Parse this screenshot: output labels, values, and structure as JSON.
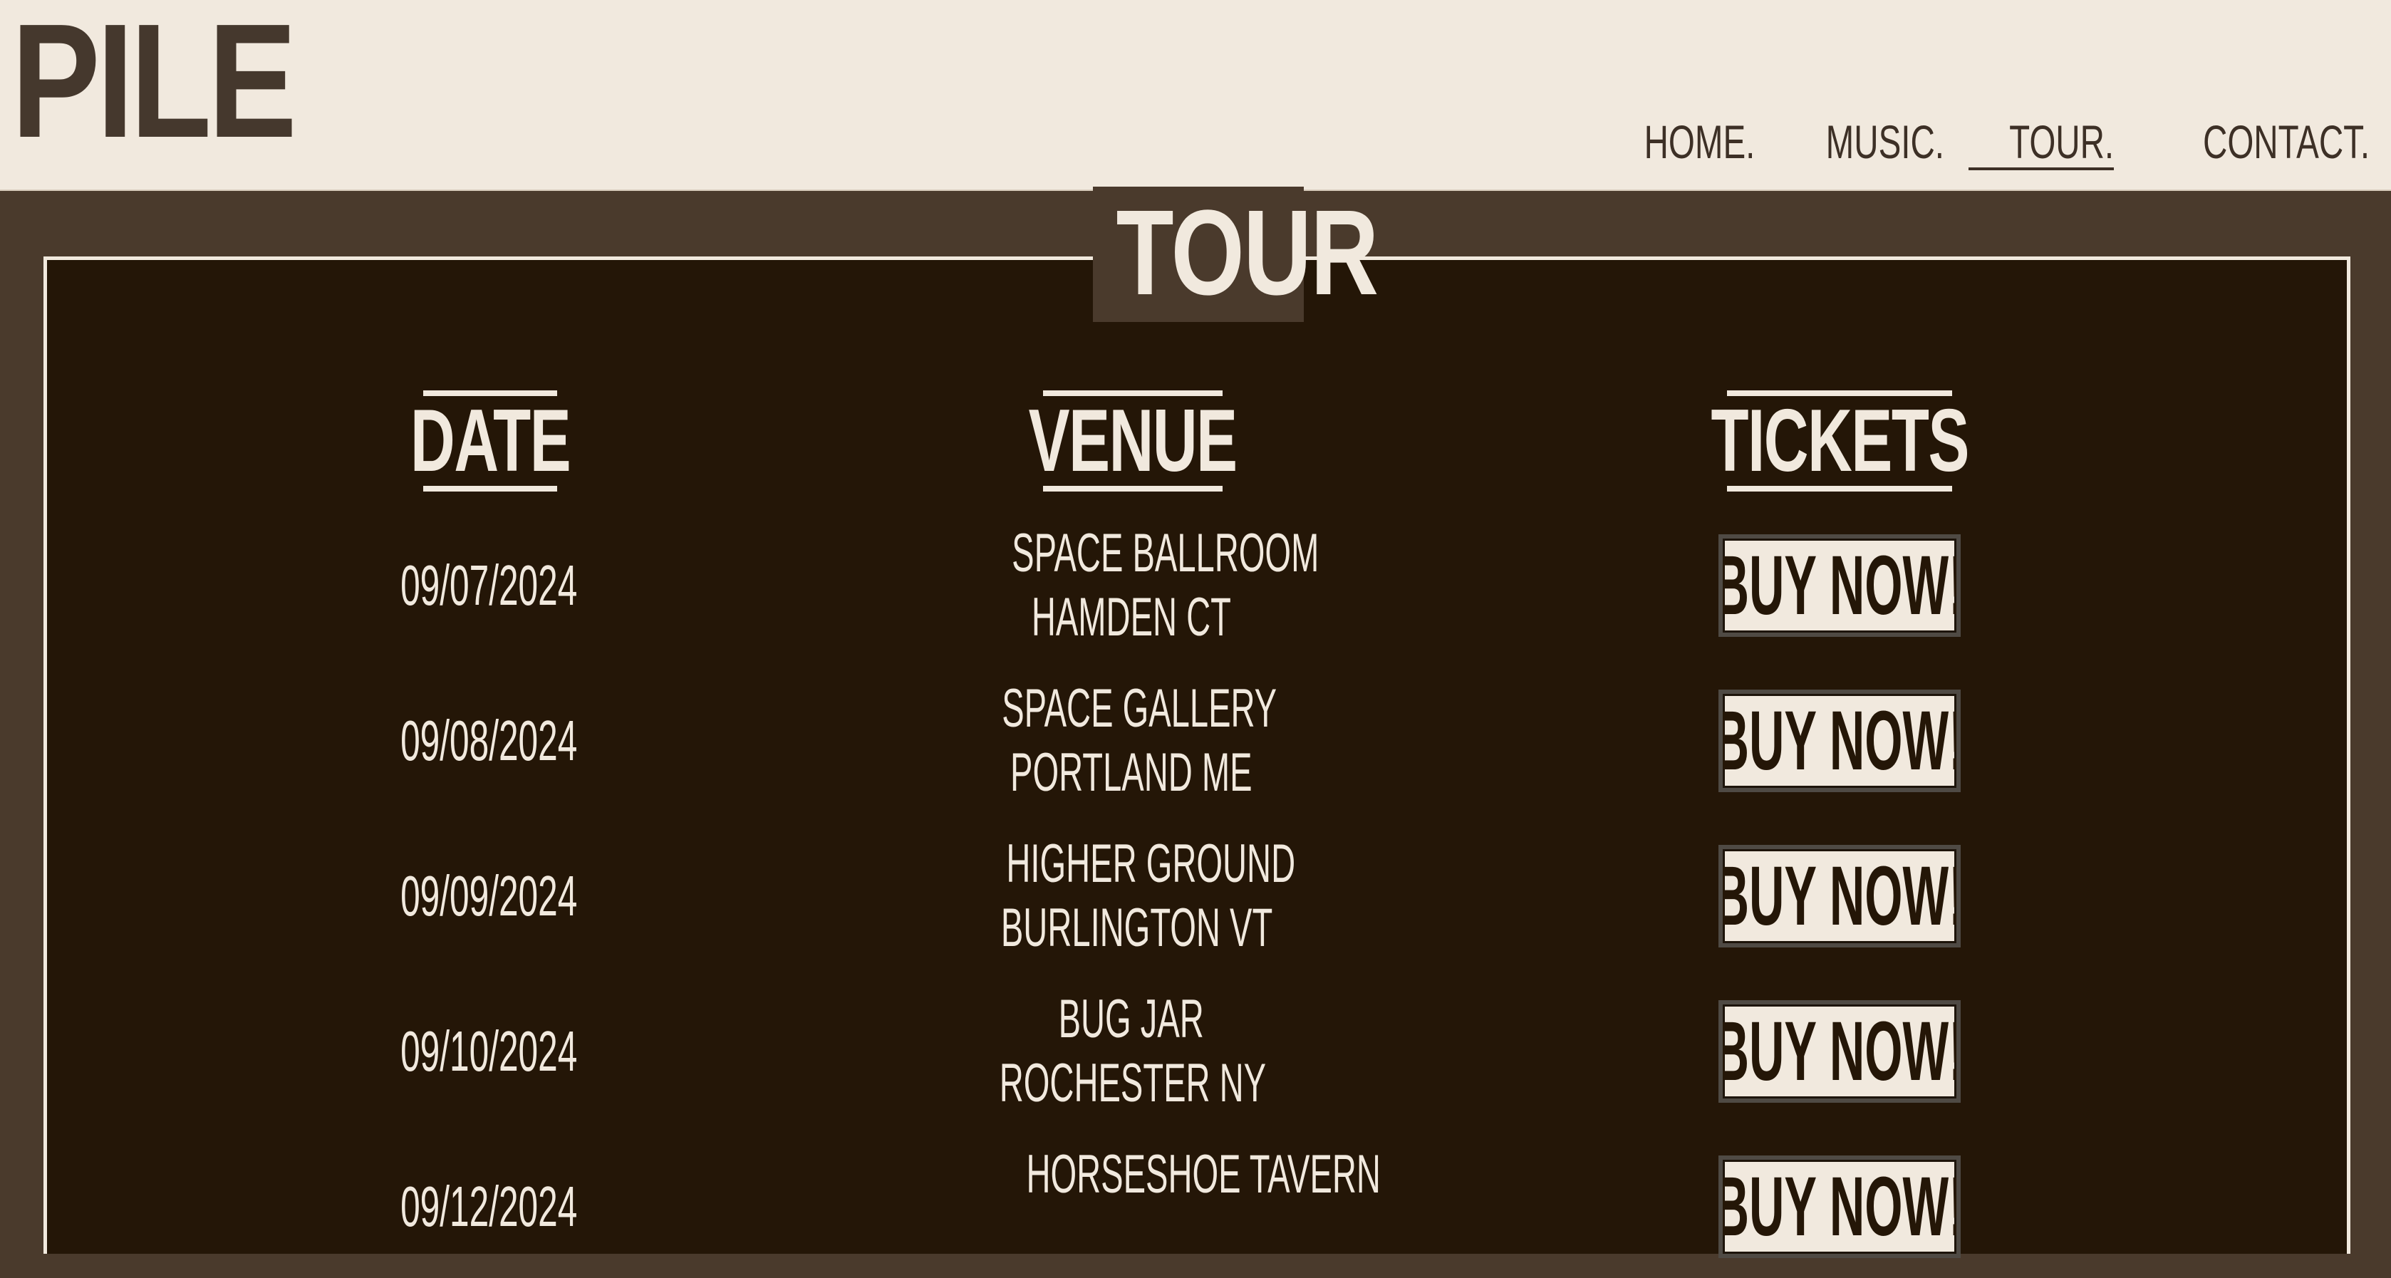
{
  "header": {
    "logo": "PILE",
    "nav": [
      {
        "label": "HOME.",
        "active": false
      },
      {
        "label": "MUSIC.",
        "active": false
      },
      {
        "label": "TOUR.",
        "active": true
      },
      {
        "label": "CONTACT.",
        "active": false
      }
    ]
  },
  "tour": {
    "title": "TOUR",
    "columns": {
      "date": "DATE",
      "venue": "VENUE",
      "tickets": "TICKETS"
    },
    "rows": [
      {
        "date": "09/07/2024",
        "venue": "SPACE BALLROOM",
        "city": "HAMDEN CT",
        "button": "BUY NOW!"
      },
      {
        "date": "09/08/2024",
        "venue": "SPACE GALLERY",
        "city": "PORTLAND ME",
        "button": "BUY NOW!"
      },
      {
        "date": "09/09/2024",
        "venue": "HIGHER GROUND",
        "city": "BURLINGTON VT",
        "button": "BUY NOW!"
      },
      {
        "date": "09/10/2024",
        "venue": "BUG JAR",
        "city": "ROCHESTER NY",
        "button": "BUY NOW!"
      },
      {
        "date": "09/12/2024",
        "venue": "HORSESHOE TAVERN",
        "city": "",
        "button": "BUY NOW!"
      }
    ]
  },
  "colors": {
    "header_bg": "#f1e9de",
    "page_bg": "#4a3a2c",
    "panel_bg": "#241607",
    "text_light": "#f1e9de",
    "text_dark": "#3d3026"
  }
}
